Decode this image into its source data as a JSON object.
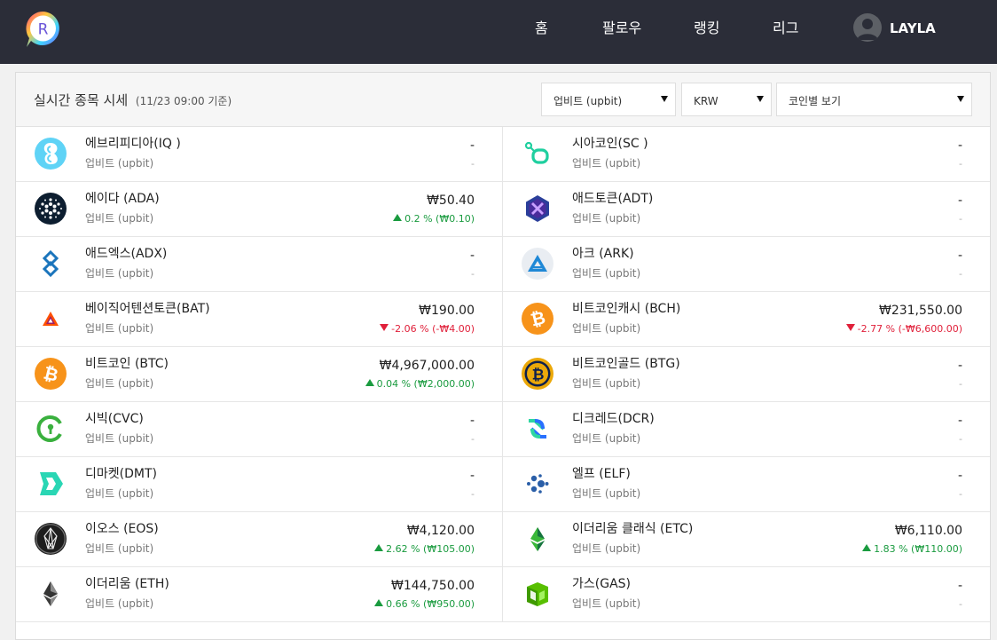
{
  "nav": {
    "logo_letter": "R",
    "items": [
      {
        "label": "홈"
      },
      {
        "label": "팔로우"
      },
      {
        "label": "랭킹"
      },
      {
        "label": "리그"
      }
    ],
    "username": "LAYLA"
  },
  "panel": {
    "title": "실시간 종목 시세",
    "subtitle": "(11/23 09:00 기준)",
    "filters": {
      "exchange": "업비트 (upbit)",
      "currency": "KRW",
      "view": "코인별 보기"
    }
  },
  "coins": [
    {
      "name": "에브리피디아(IQ )",
      "exchange": "업비트 (upbit)",
      "price": "-",
      "change": "-",
      "direction": "none",
      "icon": "everipedia-icon"
    },
    {
      "name": "시아코인(SC )",
      "exchange": "업비트 (upbit)",
      "price": "-",
      "change": "-",
      "direction": "none",
      "icon": "siacoin-icon"
    },
    {
      "name": "에이다 (ADA)",
      "exchange": "업비트 (upbit)",
      "price": "₩50.40",
      "change": "0.2 % (₩0.10)",
      "direction": "up",
      "icon": "cardano-icon"
    },
    {
      "name": "애드토큰(ADT)",
      "exchange": "업비트 (upbit)",
      "price": "-",
      "change": "-",
      "direction": "none",
      "icon": "adtoken-icon"
    },
    {
      "name": "애드엑스(ADX)",
      "exchange": "업비트 (upbit)",
      "price": "-",
      "change": "-",
      "direction": "none",
      "icon": "adex-icon"
    },
    {
      "name": "아크 (ARK)",
      "exchange": "업비트 (upbit)",
      "price": "-",
      "change": "-",
      "direction": "none",
      "icon": "ark-icon"
    },
    {
      "name": "베이직어텐션토큰(BAT)",
      "exchange": "업비트 (upbit)",
      "price": "₩190.00",
      "change": "-2.06 % (-₩4.00)",
      "direction": "down",
      "icon": "bat-icon"
    },
    {
      "name": "비트코인캐시 (BCH)",
      "exchange": "업비트 (upbit)",
      "price": "₩231,550.00",
      "change": "-2.77 % (-₩6,600.00)",
      "direction": "down",
      "icon": "bitcoin-cash-icon"
    },
    {
      "name": "비트코인 (BTC)",
      "exchange": "업비트 (upbit)",
      "price": "₩4,967,000.00",
      "change": "0.04 % (₩2,000.00)",
      "direction": "up",
      "icon": "bitcoin-icon"
    },
    {
      "name": "비트코인골드 (BTG)",
      "exchange": "업비트 (upbit)",
      "price": "-",
      "change": "-",
      "direction": "none",
      "icon": "bitcoin-gold-icon"
    },
    {
      "name": "시빅(CVC)",
      "exchange": "업비트 (upbit)",
      "price": "-",
      "change": "-",
      "direction": "none",
      "icon": "civic-icon"
    },
    {
      "name": "디크레드(DCR)",
      "exchange": "업비트 (upbit)",
      "price": "-",
      "change": "-",
      "direction": "none",
      "icon": "decred-icon"
    },
    {
      "name": "디마켓(DMT)",
      "exchange": "업비트 (upbit)",
      "price": "-",
      "change": "-",
      "direction": "none",
      "icon": "dmarket-icon"
    },
    {
      "name": "엘프 (ELF)",
      "exchange": "업비트 (upbit)",
      "price": "-",
      "change": "-",
      "direction": "none",
      "icon": "aelf-icon"
    },
    {
      "name": "이오스 (EOS)",
      "exchange": "업비트 (upbit)",
      "price": "₩4,120.00",
      "change": "2.62 % (₩105.00)",
      "direction": "up",
      "icon": "eos-icon"
    },
    {
      "name": "이더리움 클래식 (ETC)",
      "exchange": "업비트 (upbit)",
      "price": "₩6,110.00",
      "change": "1.83 % (₩110.00)",
      "direction": "up",
      "icon": "ethereum-classic-icon"
    },
    {
      "name": "이더리움 (ETH)",
      "exchange": "업비트 (upbit)",
      "price": "₩144,750.00",
      "change": "0.66 % (₩950.00)",
      "direction": "up",
      "icon": "ethereum-icon"
    },
    {
      "name": "가스(GAS)",
      "exchange": "업비트 (upbit)",
      "price": "-",
      "change": "-",
      "direction": "none",
      "icon": "gas-icon"
    }
  ]
}
